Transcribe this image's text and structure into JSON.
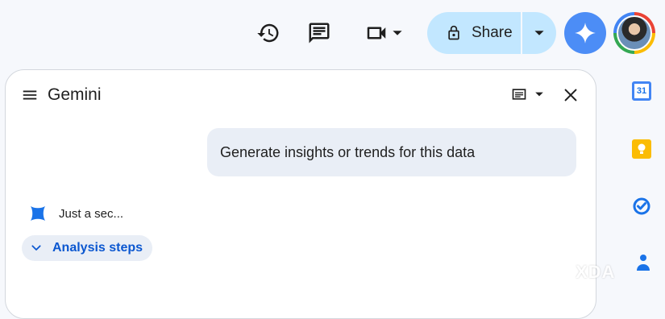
{
  "topbar": {
    "history_icon": "history-icon",
    "comments_icon": "comments-icon",
    "meet_icon": "video-camera-icon",
    "share_label": "Share",
    "share_bg": "#c2e7ff",
    "gemini_button_bg": "#4c8df6"
  },
  "panel": {
    "title": "Gemini",
    "user_prompt": "Generate insights or trends for this data",
    "response_status": "Just a sec...",
    "analysis_steps_label": "Analysis steps",
    "accent": "#0b57d0"
  },
  "side_rail": {
    "calendar_day": "31",
    "items": [
      "calendar-icon",
      "keep-icon",
      "tasks-icon",
      "contacts-icon"
    ]
  },
  "watermark": "XDA"
}
